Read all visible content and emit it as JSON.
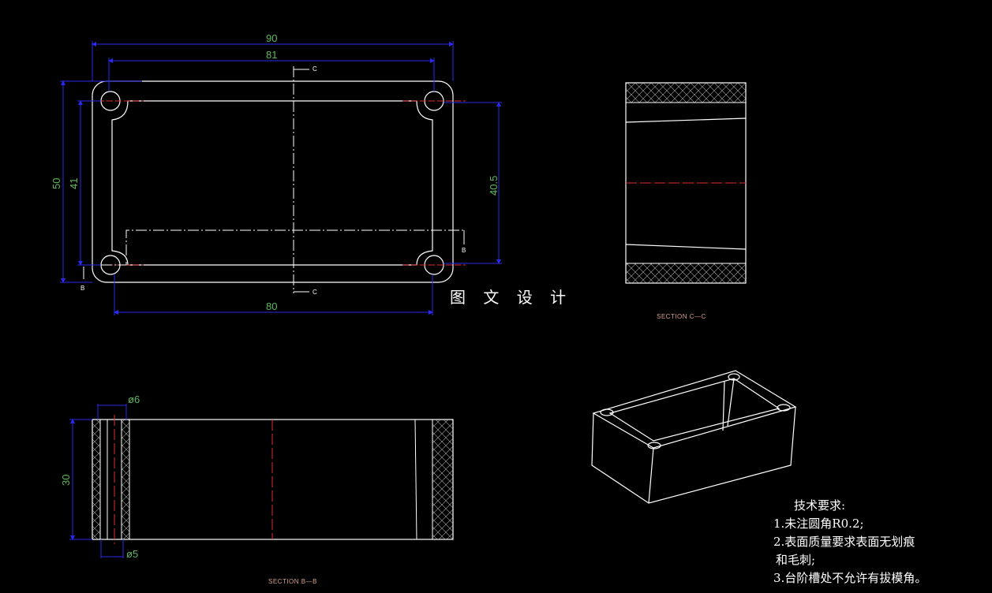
{
  "drawing": {
    "watermark": "图 文 设 计",
    "top_view": {
      "dim_overall_width": "90",
      "dim_inner_width": "81",
      "dim_bottom_width": "80",
      "dim_overall_height": "50",
      "dim_inner_height": "41",
      "dim_hole_spacing": "40.5",
      "section_mark_c_top": "C",
      "section_mark_c_bottom": "C",
      "section_mark_b_left": "B",
      "section_mark_b_right": "B"
    },
    "section_cc": {
      "label": "SECTION C—C"
    },
    "section_bb": {
      "label": "SECTION B—B",
      "dim_height": "30",
      "dim_top_dia": "ø6",
      "dim_bottom_dia": "ø5"
    },
    "notes": {
      "title": "技术要求:",
      "items": [
        "1.未注圆角R0.2;",
        "2.表面质量要求表面无划痕",
        "和毛刺;",
        "3.台阶槽处不允许有拔模角。"
      ]
    }
  },
  "colors": {
    "outline": "#ffffff",
    "dimension_line": "#2a2af0",
    "dimension_text": "#5cb85c",
    "center_line": "#e03030",
    "background": "#000000"
  }
}
